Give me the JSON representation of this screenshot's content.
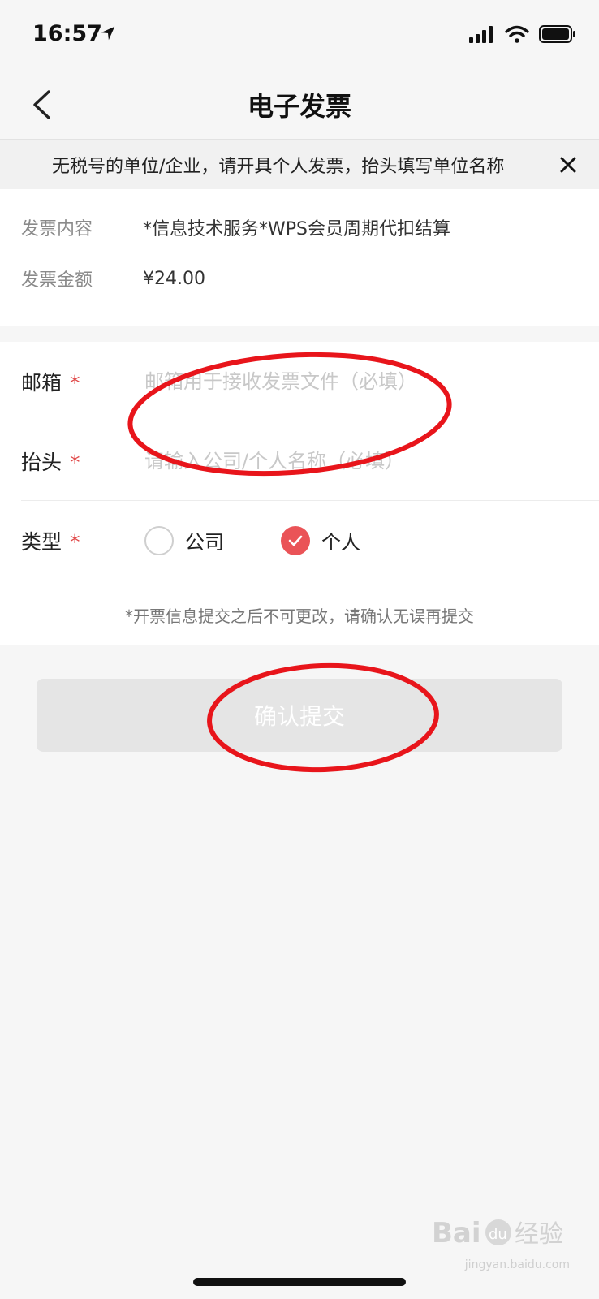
{
  "status_bar": {
    "time": "16:57",
    "icons": [
      "location-arrow-icon",
      "cellular-signal-icon",
      "wifi-icon",
      "battery-icon"
    ]
  },
  "nav": {
    "title": "电子发票",
    "back_icon": "chevron-left-icon"
  },
  "notice": {
    "text": "无税号的单位/企业，请开具个人发票，抬头填写单位名称",
    "close_icon": "close-icon"
  },
  "invoice_info": {
    "content_label": "发票内容",
    "content_value": "*信息技术服务*WPS会员周期代扣结算",
    "amount_label": "发票金额",
    "amount_value": "¥24.00"
  },
  "form": {
    "email_label": "邮箱",
    "email_value": "",
    "email_placeholder": "邮箱用于接收发票文件（必填）",
    "title_label": "抬头",
    "title_value": "",
    "title_placeholder": "请输入公司/个人名称（必填）",
    "type_label": "类型",
    "required_mark": "*",
    "type_options": [
      {
        "label": "公司",
        "selected": false
      },
      {
        "label": "个人",
        "selected": true
      }
    ],
    "note": "*开票信息提交之后不可更改，请确认无误再提交"
  },
  "submit": {
    "label": "确认提交",
    "enabled": false
  },
  "colors": {
    "accent": "#ea5357",
    "annotation": "#e8151b",
    "background": "#f6f6f6",
    "required": "#e04848"
  },
  "watermark": {
    "brand": "Bai du 经验",
    "url": "jingyan.baidu.com"
  }
}
